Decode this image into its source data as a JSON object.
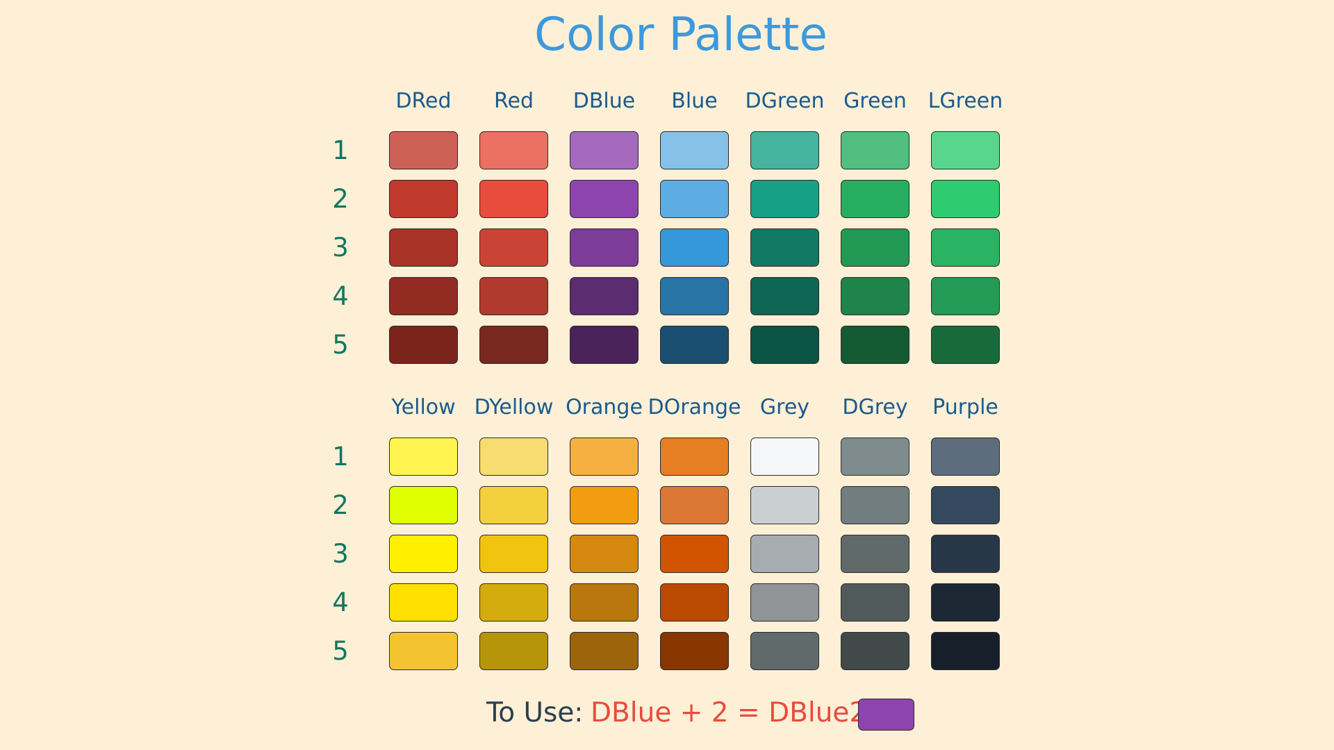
{
  "title": "Color Palette",
  "sections": [
    {
      "rows": [
        "1",
        "2",
        "3",
        "4",
        "5"
      ],
      "columns": [
        {
          "name": "DRed",
          "shades": [
            "#CD6155",
            "#C0392B",
            "#A93226",
            "#922B21",
            "#7B241C"
          ]
        },
        {
          "name": "Red",
          "shades": [
            "#EC7063",
            "#E74C3C",
            "#CB4335",
            "#B03A2E",
            "#78281F"
          ]
        },
        {
          "name": "DBlue",
          "shades": [
            "#A569BD",
            "#8E44AD",
            "#7D3C98",
            "#5B2C6F",
            "#4A235A"
          ]
        },
        {
          "name": "Blue",
          "shades": [
            "#85C1E9",
            "#5DADE2",
            "#3498DB",
            "#2874A6",
            "#1B4F72"
          ]
        },
        {
          "name": "DGreen",
          "shades": [
            "#45B39D",
            "#16A085",
            "#117A65",
            "#0E6655",
            "#0B5345"
          ]
        },
        {
          "name": "Green",
          "shades": [
            "#52BE80",
            "#27AE60",
            "#229954",
            "#1E8449",
            "#145A32"
          ]
        },
        {
          "name": "LGreen",
          "shades": [
            "#58D68D",
            "#2ECC71",
            "#28B463",
            "#239B56",
            "#186A3B"
          ]
        }
      ]
    },
    {
      "rows": [
        "1",
        "2",
        "3",
        "4",
        "5"
      ],
      "columns": [
        {
          "name": "Yellow",
          "shades": [
            "#FFF44F",
            "#DFFF00",
            "#FFF000",
            "#FFE000",
            "#F4C430"
          ]
        },
        {
          "name": "DYellow",
          "shades": [
            "#F7DC6F",
            "#F4D03F",
            "#F1C40F",
            "#D4AC0D",
            "#B7950B"
          ]
        },
        {
          "name": "Orange",
          "shades": [
            "#F5B041",
            "#F39C12",
            "#D68910",
            "#B9770E",
            "#9C640C"
          ]
        },
        {
          "name": "DOrange",
          "shades": [
            "#E67E22",
            "#DC7633",
            "#D35400",
            "#BA4A00",
            "#873600"
          ]
        },
        {
          "name": "Grey",
          "shades": [
            "#F4F6F7",
            "#CACFD2",
            "#A6ACAF",
            "#909497",
            "#616A6B"
          ]
        },
        {
          "name": "DGrey",
          "shades": [
            "#7F8C8D",
            "#717D7E",
            "#616A6B",
            "#515A5A",
            "#424949"
          ]
        },
        {
          "name": "Purple",
          "shades": [
            "#5D6D7E",
            "#34495E",
            "#283747",
            "#1C2833",
            "#17202A"
          ]
        }
      ]
    }
  ],
  "usage": {
    "label": "To Use:",
    "expression": "DBlue + 2 = DBlue2",
    "swatch_color": "#8E44AD"
  },
  "colors": {
    "background": "#FEF0D7",
    "title": "#3C99DC",
    "column_header": "#1B5A8C",
    "row_label": "#11775F",
    "usage_label": "#2C3E50",
    "usage_expression": "#E74C3C",
    "swatch_border": "#2A2A2A"
  }
}
